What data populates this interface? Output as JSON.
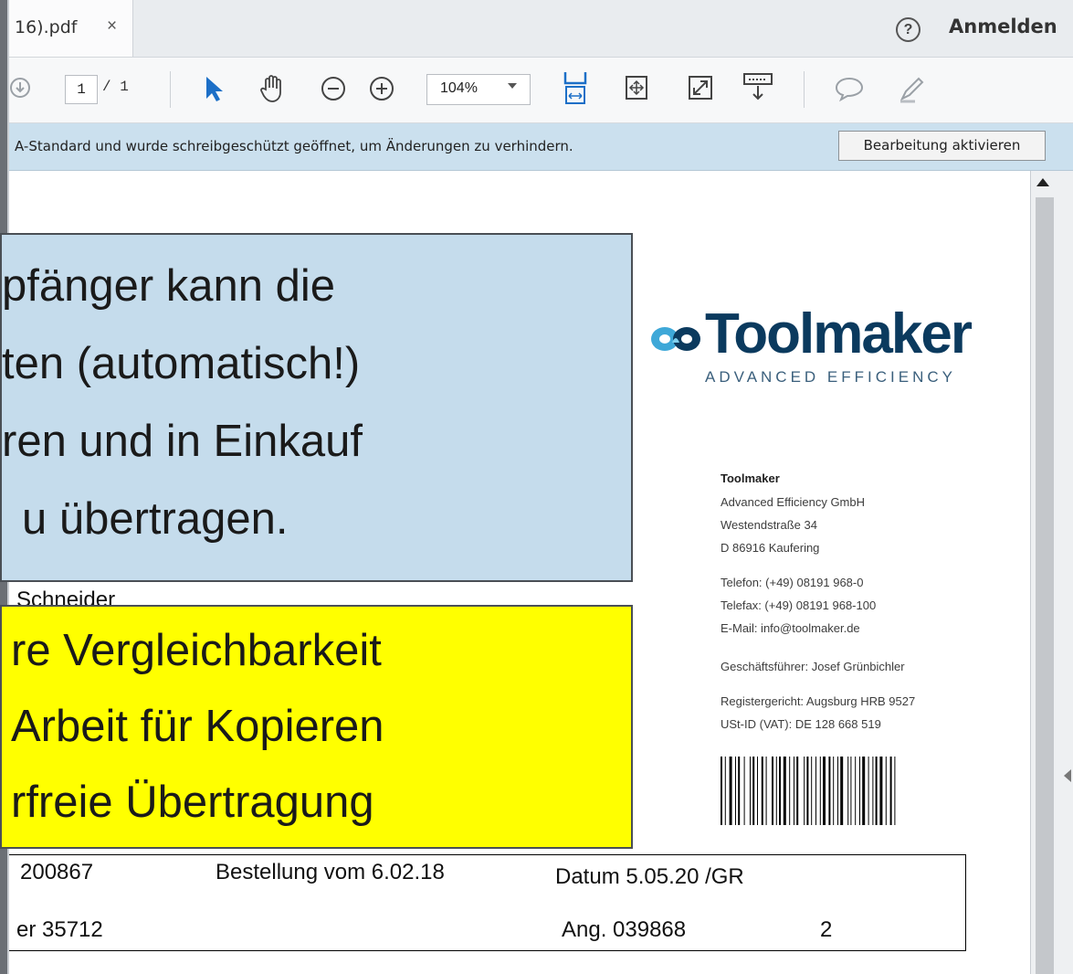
{
  "tab": {
    "label": "16).pdf",
    "close": "×"
  },
  "header": {
    "help": "?",
    "signin": "Anmelden"
  },
  "toolbar": {
    "page_current": "1",
    "page_total": "/ 1",
    "zoom": "104%"
  },
  "infobar": {
    "message": "A-Standard und wurde schreibgeschützt geöffnet, um Änderungen zu verhindern.",
    "button": "Bearbeitung aktivieren"
  },
  "document": {
    "logo": {
      "name": "Toolmaker",
      "tagline": "ADVANCED EFFICIENCY"
    },
    "address": {
      "name": "Toolmaker",
      "lines": [
        "Advanced Efficiency GmbH",
        "Westendstraße 34",
        "D 86916 Kaufering"
      ],
      "contact": [
        "Telefon: (+49) 08191 968-0",
        "Telefax: (+49) 08191 968-100",
        "E-Mail: info@toolmaker.de"
      ],
      "manager": "Geschäftsführer: Josef Grünbichler",
      "register": [
        "Registergericht: Augsburg HRB 9527",
        "USt-ID (VAT): DE 128 668 519"
      ]
    },
    "recipient_partial": "Schneider",
    "table": {
      "row1": [
        "200867",
        "Bestellung vom 6.02.18",
        "Datum 5.05.20 /GR"
      ],
      "row2": [
        "er  35712",
        "Ang.  039868",
        "2"
      ]
    }
  },
  "overlay_blue": {
    "lines": [
      "pfänger kann die",
      "ten (automatisch!)",
      "ren und in Einkauf",
      "u übertragen."
    ]
  },
  "overlay_yellow": {
    "lines": [
      "re Vergleichbarkeit",
      " Arbeit für Kopieren",
      "rfreie Übertragung"
    ]
  }
}
